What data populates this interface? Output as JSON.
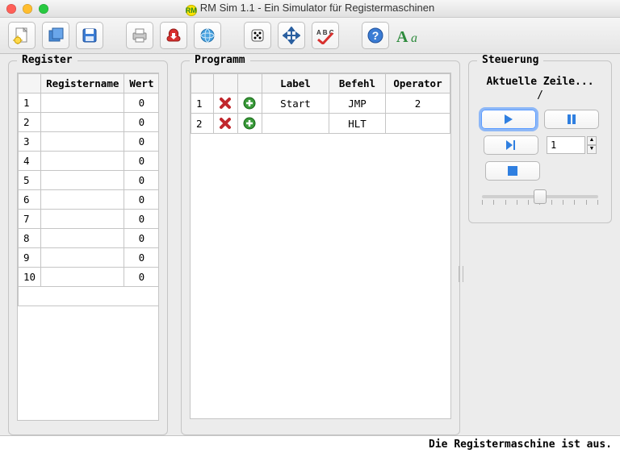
{
  "window": {
    "title": "RM Sim 1.1 - Ein Simulator für Registermaschinen",
    "icon_label": "RM"
  },
  "toolbar": {
    "icons": [
      "new",
      "open",
      "save",
      "print",
      "pdf",
      "web",
      "dice",
      "move",
      "spellcheck",
      "help",
      "font"
    ]
  },
  "register": {
    "legend": "Register",
    "columns": {
      "c0": "",
      "c1": "Registername",
      "c2": "Wert"
    },
    "rows": [
      {
        "n": "1",
        "name": "",
        "wert": "0"
      },
      {
        "n": "2",
        "name": "",
        "wert": "0"
      },
      {
        "n": "3",
        "name": "",
        "wert": "0"
      },
      {
        "n": "4",
        "name": "",
        "wert": "0"
      },
      {
        "n": "5",
        "name": "",
        "wert": "0"
      },
      {
        "n": "6",
        "name": "",
        "wert": "0"
      },
      {
        "n": "7",
        "name": "",
        "wert": "0"
      },
      {
        "n": "8",
        "name": "",
        "wert": "0"
      },
      {
        "n": "9",
        "name": "",
        "wert": "0"
      },
      {
        "n": "10",
        "name": "",
        "wert": "0"
      }
    ]
  },
  "programm": {
    "legend": "Programm",
    "columns": {
      "c0": "",
      "c1": "",
      "c2": "",
      "c3": "Label",
      "c4": "Befehl",
      "c5": "Operator"
    },
    "rows": [
      {
        "n": "1",
        "label": "Start",
        "befehl": "JMP",
        "operator": "2"
      },
      {
        "n": "2",
        "label": "",
        "befehl": "HLT",
        "operator": ""
      }
    ]
  },
  "steuerung": {
    "legend": "Steuerung",
    "title": "Aktuelle Zeile...",
    "slash": "/",
    "step_value": "1"
  },
  "status": {
    "text": "Die Registermaschine ist aus."
  }
}
